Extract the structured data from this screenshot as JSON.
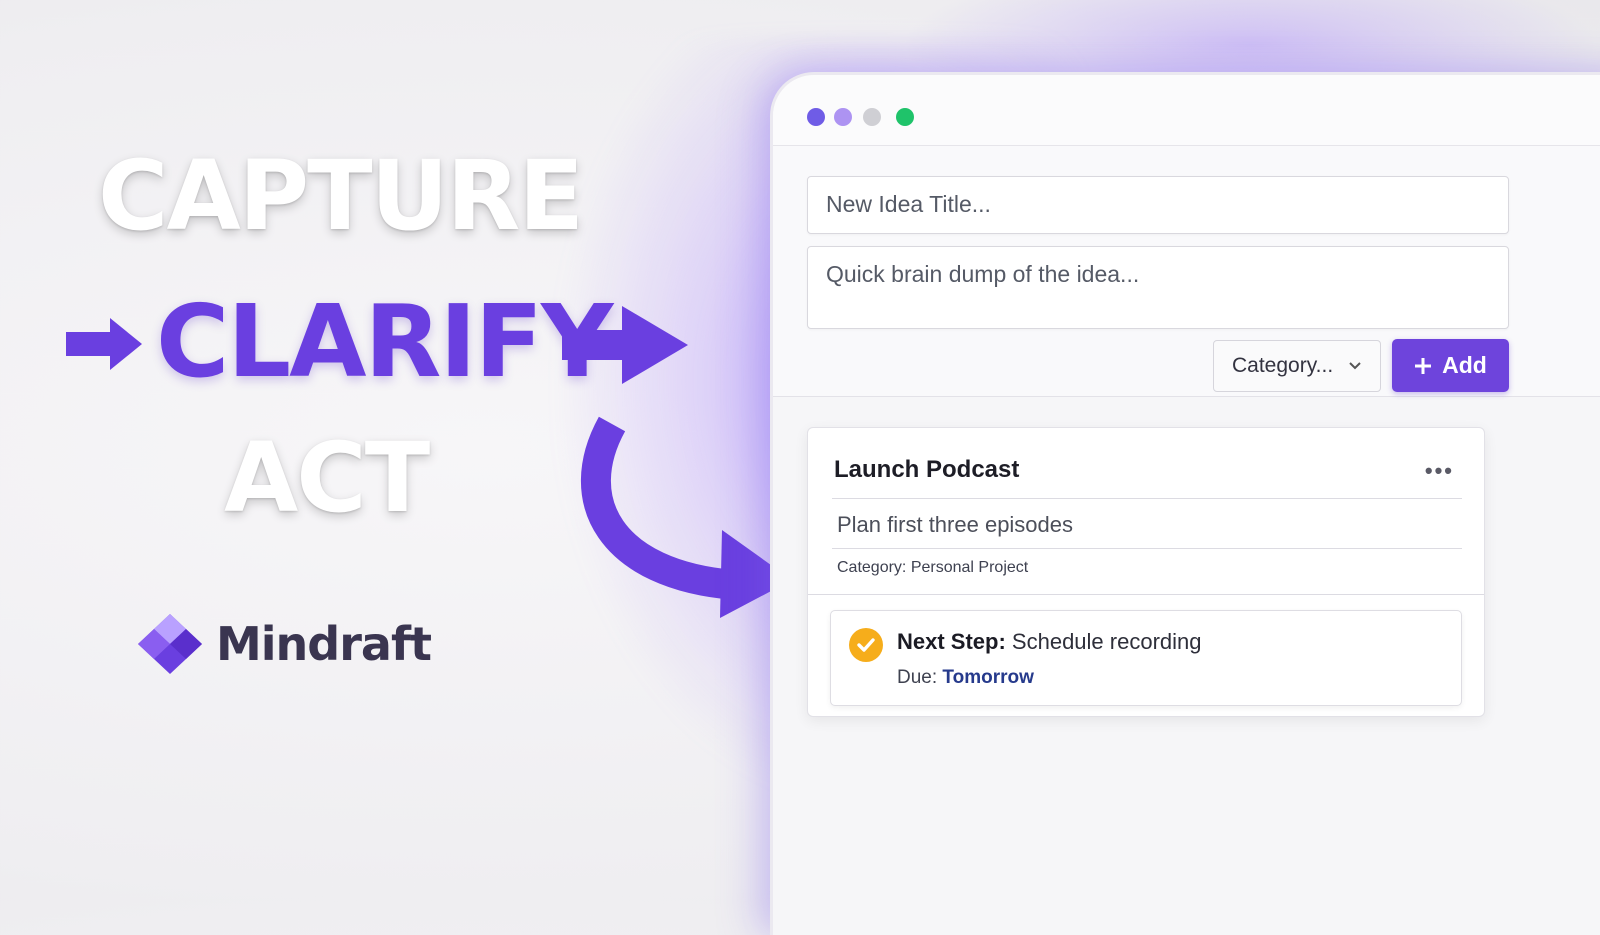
{
  "headline": {
    "capture": "CAPTURE",
    "clarify": "CLARIFY",
    "act": "ACT"
  },
  "brand": {
    "name": "Mindraft",
    "accent": "#6a3fe0"
  },
  "window": {
    "controls": [
      "purple-dot",
      "lavender-dot",
      "gray-dot",
      "green-dot"
    ]
  },
  "form": {
    "title_placeholder": "New Idea Title...",
    "description_placeholder": "Quick brain dump of the idea...",
    "category_label": "Category...",
    "add_label": "Add",
    "add_icon": "plus-icon"
  },
  "idea_card": {
    "title": "Launch Podcast",
    "more_label": "•••",
    "description": "Plan first three episodes",
    "category_label": "Category:",
    "category_value": "Personal Project",
    "next_step": {
      "label": "Next Step:",
      "value": "Schedule recording",
      "due_label": "Due:",
      "due_value": "Tomorrow",
      "status_color": "#f6ad1b"
    }
  }
}
